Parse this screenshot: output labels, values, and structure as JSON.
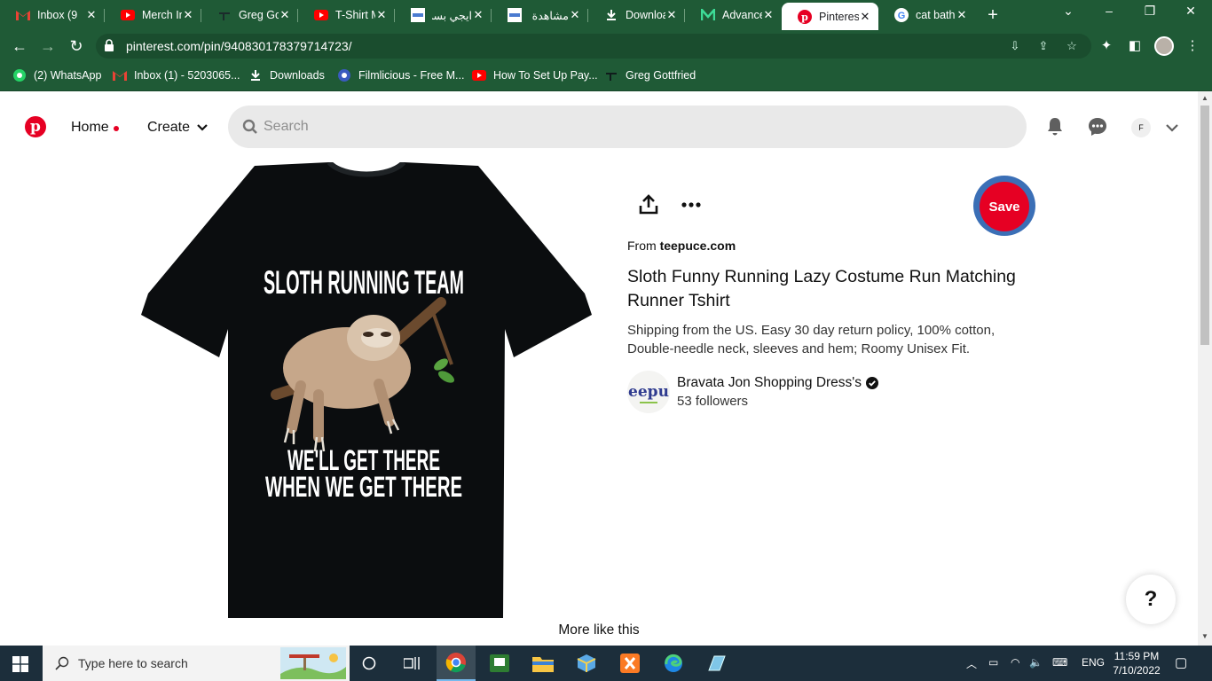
{
  "browser": {
    "tabs": [
      {
        "title": "Inbox (9",
        "favicon": "gmail-icon",
        "active": false
      },
      {
        "title": "Merch In",
        "favicon": "youtube-icon",
        "active": false
      },
      {
        "title": "Greg Go",
        "favicon": "greg-icon",
        "active": false
      },
      {
        "title": "T-Shirt M",
        "favicon": "youtube-icon",
        "active": false
      },
      {
        "title": "ايجي بست",
        "favicon": "egybest-icon",
        "active": false
      },
      {
        "title": "مشاهدة",
        "favicon": "egybest-icon",
        "active": false
      },
      {
        "title": "Downloa",
        "favicon": "download-icon",
        "active": false
      },
      {
        "title": "Advance",
        "favicon": "m-icon",
        "active": false
      },
      {
        "title": "Pinterest",
        "favicon": "pinterest-icon",
        "active": true
      },
      {
        "title": "cat bath",
        "favicon": "google-icon",
        "active": false
      }
    ],
    "url": "pinterest.com/pin/940830178379714723/",
    "bookmarks": [
      {
        "label": "(2) WhatsApp",
        "icon": "whatsapp-icon"
      },
      {
        "label": "Inbox (1) - 5203065...",
        "icon": "gmail-icon"
      },
      {
        "label": "Downloads",
        "icon": "download-icon"
      },
      {
        "label": "Filmlicious - Free M...",
        "icon": "film-icon"
      },
      {
        "label": "How To Set Up Pay...",
        "icon": "youtube-icon"
      },
      {
        "label": "Greg Gottfried",
        "icon": "greg-icon"
      }
    ]
  },
  "header": {
    "home_label": "Home",
    "create_label": "Create",
    "search_placeholder": "Search",
    "avatar_letter": "F"
  },
  "pin": {
    "image_text_top": "SLOTH RUNNING TEAM",
    "image_text_bottom_1": "WE'LL GET THERE",
    "image_text_bottom_2": "WHEN WE GET THERE",
    "save_label": "Save",
    "from_prefix": "From",
    "source": "teepuce.com",
    "title": "Sloth Funny Running Lazy Costume Run Matching Runner Tshirt",
    "description": "Shipping from the US. Easy 30 day return policy, 100% cotton, Double-needle neck, sleeves and hem; Roomy Unisex Fit.",
    "creator_name": "Bravata Jon Shopping Dress's",
    "creator_avatar_text": "eepu",
    "followers": "53 followers",
    "more_like_this": "More like this",
    "help_label": "?"
  },
  "taskbar": {
    "search_text": "Type here to search",
    "language": "ENG",
    "time": "11:59 PM",
    "date": "7/10/2022"
  },
  "colors": {
    "pinterest_red": "#e60023",
    "chrome_green": "#1f5a36",
    "taskbar": "#1c2e3b"
  }
}
